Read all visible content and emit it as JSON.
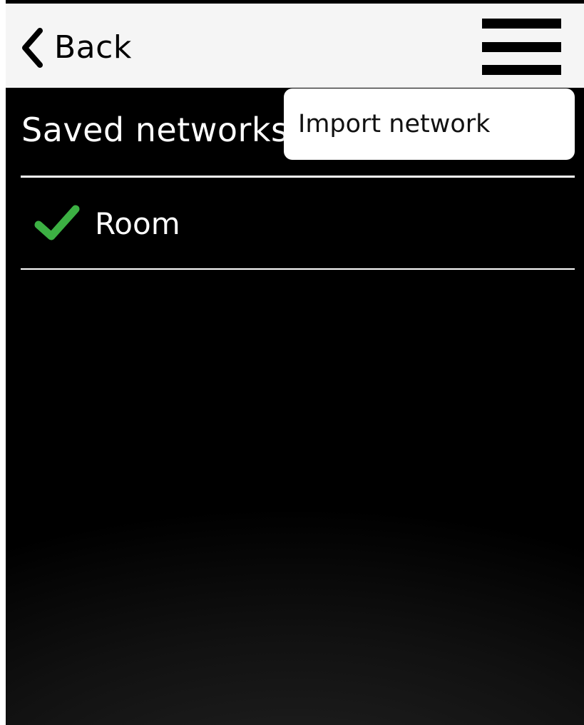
{
  "header": {
    "back_label": "Back",
    "back_icon": "chevron-left-icon",
    "menu_icon": "hamburger-menu-icon"
  },
  "main": {
    "title": "Saved networks",
    "networks": [
      {
        "name": "Room",
        "status_icon": "checkmark-icon",
        "connected": true
      }
    ]
  },
  "menu": {
    "items": [
      {
        "label": "Import network"
      }
    ]
  },
  "colors": {
    "header_background": "#f5f5f5",
    "screen_background": "#000000",
    "check_green": "#3cb043",
    "text_light": "#ffffff",
    "text_dark": "#000000"
  }
}
